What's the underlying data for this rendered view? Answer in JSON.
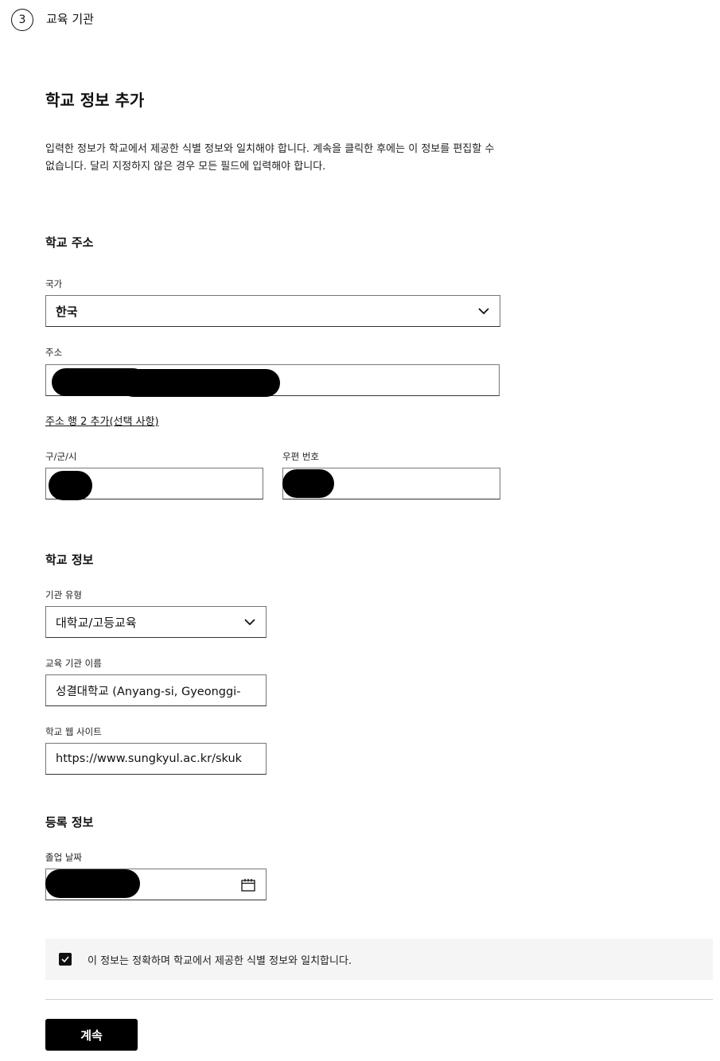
{
  "step": {
    "number": "3",
    "title": "교육 기관"
  },
  "page": {
    "title": "학교 정보 추가",
    "description": "입력한 정보가 학교에서 제공한 식별 정보와 일치해야 합니다. 계속을 클릭한 후에는 이 정보를 편집할 수 없습니다. 달리 지정하지 않은 경우 모든 필드에 입력해야 합니다."
  },
  "address": {
    "heading": "학교 주소",
    "country_label": "국가",
    "country_value": "한국",
    "address_label": "주소",
    "add_line_link": "주소 행 2 추가(선택 사항)",
    "city_label": "구/군/시",
    "zip_label": "우편 번호"
  },
  "school": {
    "heading": "학교 정보",
    "type_label": "기관 유형",
    "type_value": "대학교/고등교육",
    "name_label": "교육 기관 이름",
    "name_value": "성결대학교 (Anyang-si, Gyeonggi-",
    "website_label": "학교 웹 사이트",
    "website_value": "https://www.sungkyul.ac.kr/skuk"
  },
  "enrollment": {
    "heading": "등록 정보",
    "grad_label": "졸업 날짜"
  },
  "confirm": {
    "checked": true,
    "text": "이 정보는 정확하며 학교에서 제공한 식별 정보와 일치합니다."
  },
  "actions": {
    "continue_label": "계속"
  },
  "icons": {
    "dropdown": "chevron-down-icon",
    "calendar": "calendar-icon",
    "check": "check-icon"
  },
  "colors": {
    "primary": "#000000",
    "panel": "#f5f5f5",
    "border": "#767676"
  }
}
